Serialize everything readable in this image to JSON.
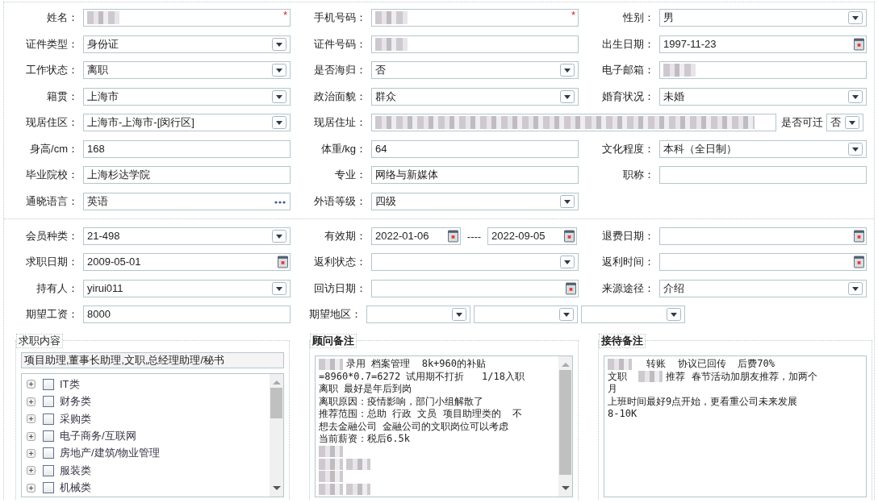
{
  "profile": {
    "rows": [
      [
        {
          "label": "姓名：",
          "kind": "text",
          "redacted": true,
          "required_mark": "*"
        },
        {
          "label": "手机号码：",
          "kind": "text",
          "redacted": true,
          "required_mark": "*"
        },
        {
          "label": "性别：",
          "kind": "select",
          "value": "男"
        }
      ],
      [
        {
          "label": "证件类型：",
          "kind": "select",
          "value": "身份证"
        },
        {
          "label": "证件号码：",
          "kind": "text",
          "redacted": true
        },
        {
          "label": "出生日期：",
          "kind": "date",
          "value": "1997-11-23"
        }
      ],
      [
        {
          "label": "工作状态：",
          "kind": "select",
          "value": "离职"
        },
        {
          "label": "是否海归：",
          "kind": "select",
          "value": "否"
        },
        {
          "label": "电子邮箱：",
          "kind": "text",
          "redacted": true
        }
      ],
      [
        {
          "label": "籍贯：",
          "kind": "select",
          "value": "上海市"
        },
        {
          "label": "政治面貌：",
          "kind": "select",
          "value": "群众"
        },
        {
          "label": "婚育状况：",
          "kind": "select",
          "value": "未婚"
        }
      ],
      [
        {
          "label": "现居住区：",
          "kind": "select",
          "value": " 上海市-上海市-[闵行区]"
        },
        {
          "label": "现居住址：",
          "kind": "wide-text",
          "redacted": true
        },
        {
          "label": "是否可迁",
          "kind": "mini-select",
          "value": "否"
        }
      ],
      [
        {
          "label": "身高/cm：",
          "kind": "text",
          "value": "168"
        },
        {
          "label": "体重/kg：",
          "kind": "text",
          "value": "64"
        },
        {
          "label": "文化程度：",
          "kind": "select",
          "value": "本科（全日制）"
        }
      ],
      [
        {
          "label": "毕业院校：",
          "kind": "text",
          "value": "上海杉达学院"
        },
        {
          "label": "专业：",
          "kind": "text",
          "value": "网络与新媒体"
        },
        {
          "label": "职称：",
          "kind": "text"
        }
      ],
      [
        {
          "label": "通晓语言：",
          "kind": "lookup",
          "value": "英语"
        },
        {
          "label": "外语等级：",
          "kind": "select",
          "value": "四级"
        }
      ]
    ]
  },
  "membership": {
    "rows": [
      [
        {
          "label": "会员种类：",
          "kind": "select",
          "value": " 21-498"
        },
        {
          "label": "有效期：",
          "kind": "daterange",
          "values": [
            "2022-01-06",
            "2022-09-05"
          ],
          "separator": "----"
        },
        {
          "label": "退费日期：",
          "kind": "date"
        }
      ],
      [
        {
          "label": "求职日期：",
          "kind": "date",
          "value": "2009-05-01"
        },
        {
          "label": "返利状态：",
          "kind": "select"
        },
        {
          "label": "返利时间：",
          "kind": "date"
        }
      ],
      [
        {
          "label": "持有人：",
          "kind": "select",
          "value": "yirui011"
        },
        {
          "label": "回访日期：",
          "kind": "date"
        },
        {
          "label": "来源途径：",
          "kind": "select",
          "value": "介绍"
        }
      ],
      [
        {
          "label": "期望工资：",
          "kind": "text",
          "value": "8000"
        },
        {
          "label": "期望地区：",
          "kind": "multiselect",
          "selects": [
            {
              "kind": "select"
            },
            {
              "kind": "select"
            },
            {
              "kind": "select"
            }
          ]
        }
      ]
    ]
  },
  "job_intent": {
    "title": "求职内容",
    "summary": "项目助理,董事长助理,文职,总经理助理/秘书",
    "items": [
      {
        "label": "IT类",
        "checked": false,
        "expanded": false
      },
      {
        "label": "财务类",
        "checked": false,
        "expanded": false
      },
      {
        "label": "采购类",
        "checked": false,
        "expanded": false
      },
      {
        "label": "电子商务/互联网",
        "checked": false,
        "expanded": false
      },
      {
        "label": "房地产/建筑/物业管理",
        "checked": false,
        "expanded": false
      },
      {
        "label": "服装类",
        "checked": false,
        "expanded": false
      },
      {
        "label": "机械类",
        "checked": false,
        "expanded": false
      }
    ]
  },
  "notes": [
    {
      "title": "顾问备注",
      "scrollbar": true,
      "lines": [
        [
          {
            "kind": "redacted"
          },
          {
            "kind": "text",
            "text": "录用 档案管理  8k+960的补贴"
          }
        ],
        [
          {
            "kind": "text",
            "text": "=8960*0.7=6272 试用期不打折   1/18入职"
          }
        ],
        [
          {
            "kind": "text",
            "text": "离职 最好是年后到岗"
          }
        ],
        [
          {
            "kind": "text",
            "text": "离职原因：疫情影响，部门小组解散了"
          }
        ],
        [
          {
            "kind": "text",
            "text": "推荐范围：总助 行政 文员 项目助理类的  不"
          }
        ],
        [
          {
            "kind": "text",
            "text": "想去金融公司 金融公司的文职岗位可以考虑"
          }
        ],
        [
          {
            "kind": "text",
            "text": "当前薪资：税后6.5k"
          }
        ],
        [
          {
            "kind": "redacted"
          }
        ],
        [
          {
            "kind": "redacted"
          },
          {
            "kind": "redacted"
          }
        ],
        [
          {
            "kind": "redacted"
          }
        ],
        [
          {
            "kind": "redacted"
          },
          {
            "kind": "redacted"
          }
        ]
      ]
    },
    {
      "title": "接待备注",
      "scrollbar": false,
      "lines": [
        [
          {
            "kind": "redacted"
          },
          {
            "kind": "text",
            "text": "  转账  协议已回传  后费70%"
          }
        ],
        [
          {
            "kind": "text",
            "text": "文职  "
          },
          {
            "kind": "redacted"
          },
          {
            "kind": "text",
            "text": "推荐 春节活动加朋友推荐，加两个"
          }
        ],
        [
          {
            "kind": "text",
            "text": "月"
          }
        ],
        [
          {
            "kind": "text",
            "text": "上班时间最好9点开始，更看重公司未来发展"
          }
        ],
        [
          {
            "kind": "text",
            "text": "8-10K"
          }
        ]
      ]
    }
  ]
}
